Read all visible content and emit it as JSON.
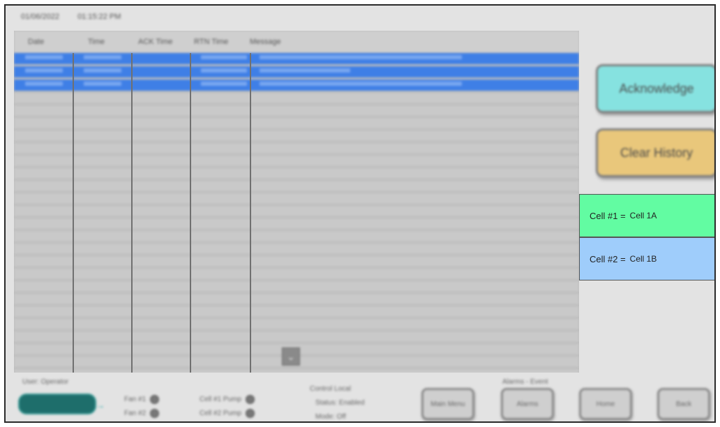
{
  "header": {
    "date": "01/06/2022",
    "time": "01:15:22 PM"
  },
  "table": {
    "columns": [
      "Date",
      "Time",
      "ACK Time",
      "RTN Time",
      "Message"
    ],
    "selected_row_count": 3,
    "total_row_count": 26
  },
  "buttons": {
    "acknowledge": "Acknowledge",
    "clear_history": "Clear History"
  },
  "cells": [
    {
      "label": "Cell #1 =",
      "value": "Cell 1A",
      "color": "#62fca2"
    },
    {
      "label": "Cell #2 =",
      "value": "Cell 1B",
      "color": "#9fcdfb"
    }
  ],
  "footer": {
    "user_label": "User: Operator",
    "statuses": [
      "Fan #1",
      "Fan #2",
      "Cell #1 Pump",
      "Cell #2 Pump"
    ],
    "control": {
      "title": "Control Local",
      "status": "Status: Enabled",
      "mode": "Mode: Off"
    },
    "nav_label": "Alarms - Event",
    "nav_buttons": [
      "Main Menu",
      "Alarms",
      "Home",
      "Back"
    ]
  },
  "colors": {
    "selected_row": "#3f7fe6",
    "acknowledge": "#86e2e0",
    "clear": "#e9c77b"
  }
}
